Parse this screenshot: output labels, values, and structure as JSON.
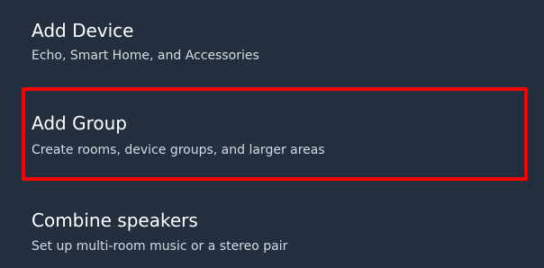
{
  "menu": {
    "items": [
      {
        "title": "Add Device",
        "subtitle": "Echo, Smart Home, and Accessories"
      },
      {
        "title": "Add Group",
        "subtitle": "Create rooms, device groups, and larger areas"
      },
      {
        "title": "Combine speakers",
        "subtitle": "Set up multi-room music or a stereo pair"
      }
    ],
    "highlighted_item": "Add Group"
  },
  "colors": {
    "background": "#232f3e",
    "title_text": "#ffffff",
    "subtitle_text": "#d6dbe0",
    "highlight_border": "#ff0000"
  }
}
